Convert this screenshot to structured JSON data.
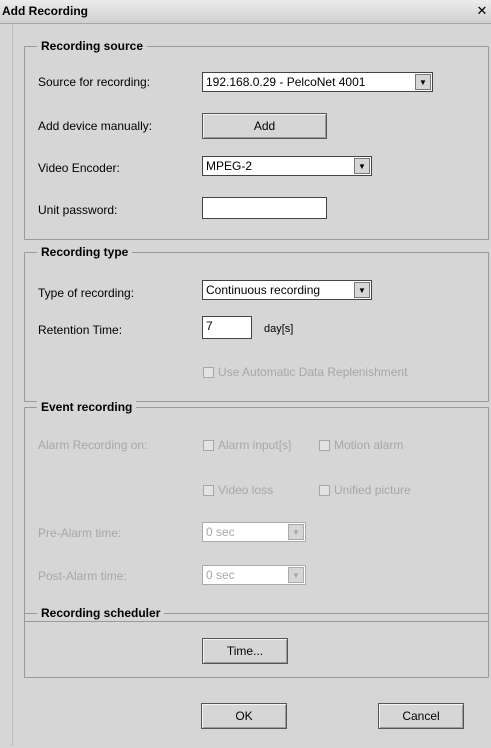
{
  "window": {
    "title": "Add Recording",
    "close_glyph": "✕"
  },
  "recording_source": {
    "title": "Recording source",
    "source_label": "Source for recording:",
    "source_value": "192.168.0.29 - PelcoNet 4001",
    "add_device_label": "Add device manually:",
    "add_button": "Add",
    "encoder_label": "Video Encoder:",
    "encoder_value": "MPEG-2",
    "password_label": "Unit password:",
    "password_value": ""
  },
  "recording_type": {
    "title": "Recording type",
    "type_label": "Type of recording:",
    "type_value": "Continuous recording",
    "retention_label": "Retention Time:",
    "retention_value": "7",
    "retention_unit": "day[s]",
    "auto_replenish_label": "Use Automatic Data Replenishment",
    "auto_replenish_checked": false
  },
  "event_recording": {
    "title": "Event recording",
    "alarm_on_label": "Alarm Recording on:",
    "alarm_inputs_label": "Alarm input[s]",
    "motion_alarm_label": "Motion alarm",
    "video_loss_label": "Video loss",
    "unified_picture_label": "Unified picture",
    "pre_alarm_label": "Pre-Alarm time:",
    "pre_alarm_value": "0 sec",
    "post_alarm_label": "Post-Alarm time:",
    "post_alarm_value": "0 sec"
  },
  "scheduler": {
    "title": "Recording scheduler",
    "time_button": "Time..."
  },
  "footer": {
    "ok_button": "OK",
    "cancel_button": "Cancel"
  },
  "icons": {
    "dropdown_arrow": "▼"
  }
}
